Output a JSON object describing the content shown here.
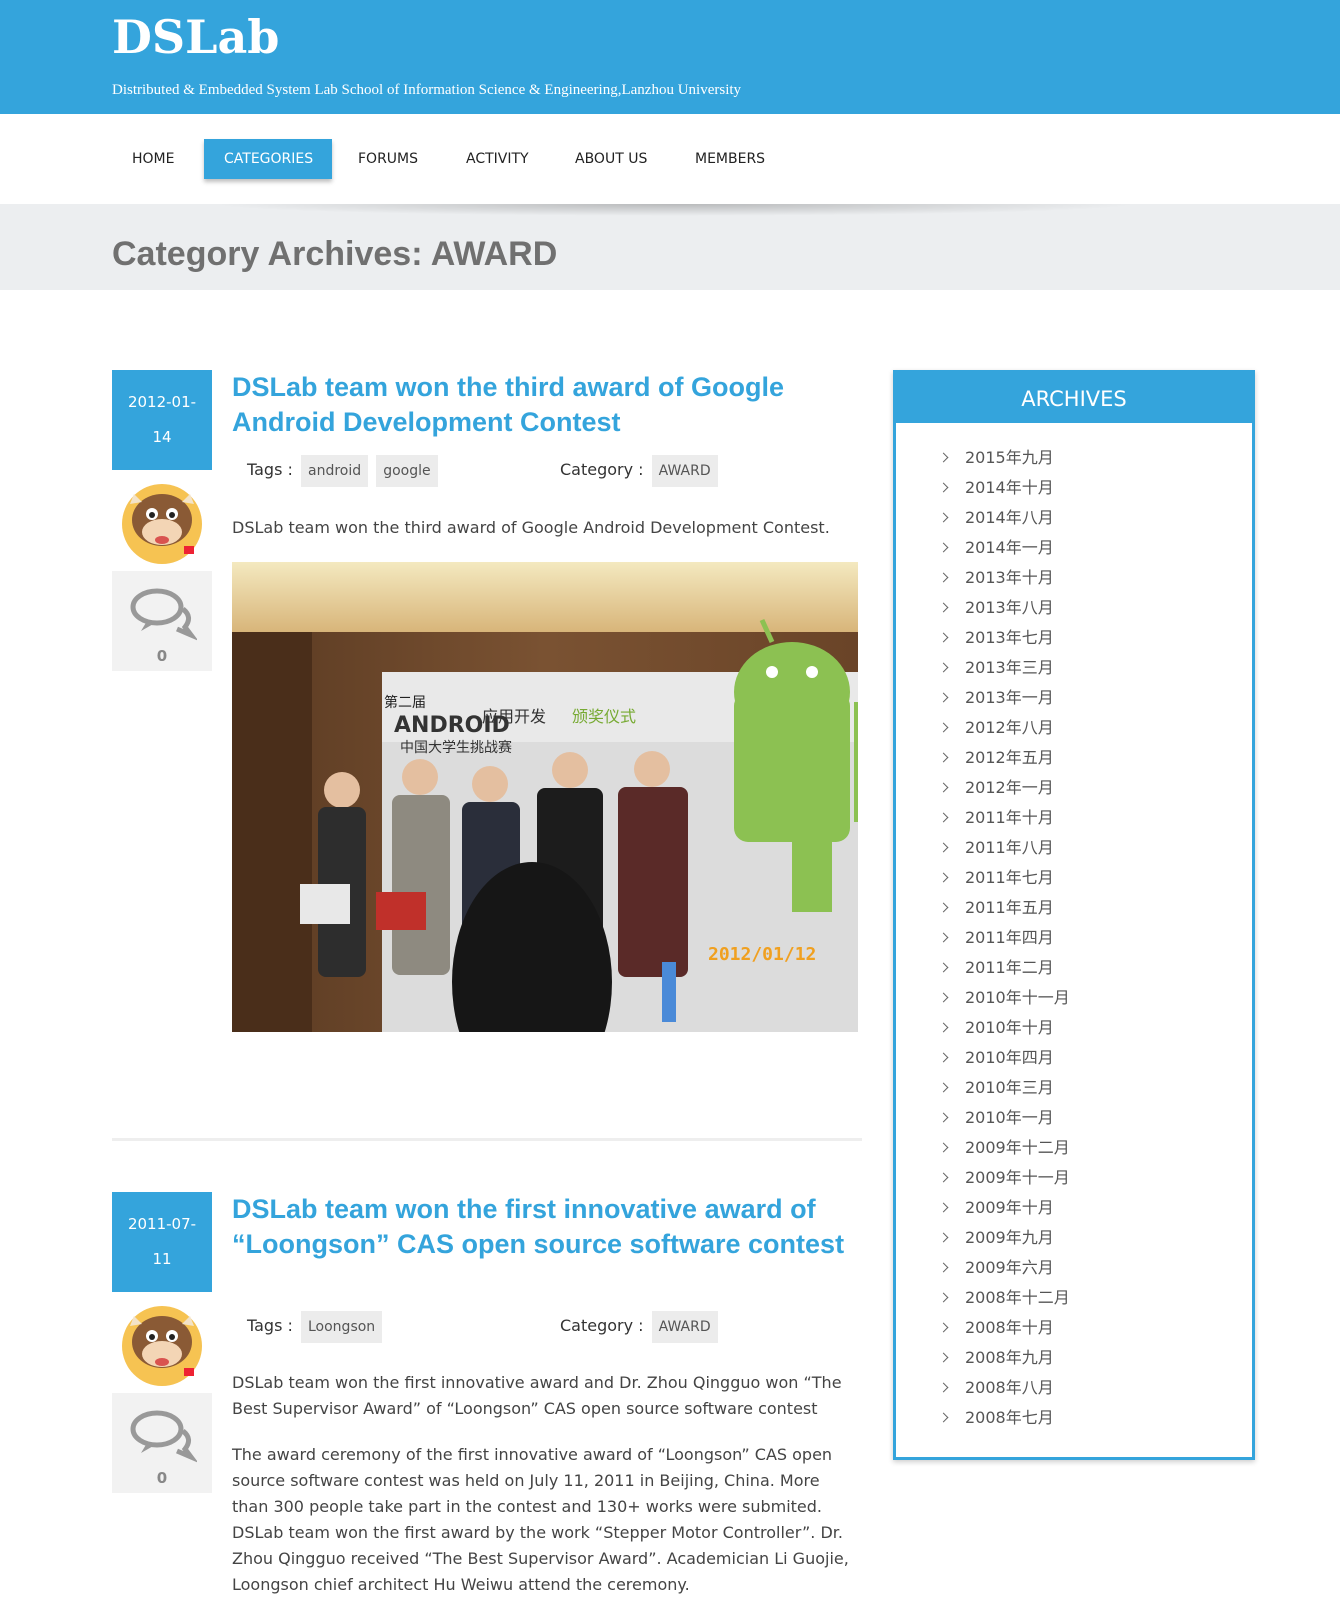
{
  "site": {
    "title": "DSLab",
    "description": "Distributed & Embedded System Lab School of Information Science & Engineering,Lanzhou University"
  },
  "nav": {
    "items": [
      {
        "label": "HOME"
      },
      {
        "label": "CATEGORIES",
        "active": true
      },
      {
        "label": "FORUMS"
      },
      {
        "label": "ACTIVITY"
      },
      {
        "label": "ABOUT US"
      },
      {
        "label": "MEMBERS"
      }
    ]
  },
  "page": {
    "title": "Category Archives: AWARD"
  },
  "posts": [
    {
      "date_line1": "2012-01-",
      "date_line2": "14",
      "title": "DSLab team won the third award of Google Android Development Contest",
      "tags_label": "Tags :",
      "tags": [
        "android",
        "google"
      ],
      "category_label": "Category :",
      "category": "AWARD",
      "excerpt": "DSLab team won the third award of Google Android Development Contest.",
      "comments": "0",
      "image": {
        "poster_logo": "ANDROID",
        "poster_text_1": "应用开发",
        "poster_text_2": "中国大学生挑战赛",
        "poster_text_3": "颁奖仪式",
        "poster_tag": "第二届",
        "date_stamp": "2012/01/12"
      }
    },
    {
      "date_line1": "2011-07-",
      "date_line2": "11",
      "title": "DSLab team won the first innovative award of “Loongson” CAS open source software contest",
      "tags_label": "Tags :",
      "tags": [
        "Loongson"
      ],
      "category_label": "Category :",
      "category": "AWARD",
      "excerpt": "DSLab team won the first innovative award and Dr. Zhou Qingguo won “The Best Supervisor Award” of “Loongson” CAS open source software contest",
      "body": "The award ceremony of the first innovative award of “Loongson” CAS open source software contest was held on July 11, 2011 in Beijing, China. More than 300 people take part in the contest and 130+ works were submited. DSLab team won the first award by the work “Stepper Motor Controller”. Dr. Zhou Qingguo received “The Best Supervisor Award”. Academician Li Guojie, Loongson chief architect Hu Weiwu attend the ceremony.",
      "comments": "0"
    }
  ],
  "sidebar": {
    "title": "ARCHIVES",
    "archives": [
      "2015年九月",
      "2014年十月",
      "2014年八月",
      "2014年一月",
      "2013年十月",
      "2013年八月",
      "2013年七月",
      "2013年三月",
      "2013年一月",
      "2012年八月",
      "2012年五月",
      "2012年一月",
      "2011年十月",
      "2011年八月",
      "2011年七月",
      "2011年五月",
      "2011年四月",
      "2011年二月",
      "2010年十一月",
      "2010年十月",
      "2010年四月",
      "2010年三月",
      "2010年一月",
      "2009年十二月",
      "2009年十一月",
      "2009年十月",
      "2009年九月",
      "2009年六月",
      "2008年十二月",
      "2008年十月",
      "2008年九月",
      "2008年八月",
      "2008年七月"
    ]
  },
  "colors": {
    "accent": "#34a4dc",
    "banner": "#eceef0",
    "title_gray": "#707070"
  }
}
